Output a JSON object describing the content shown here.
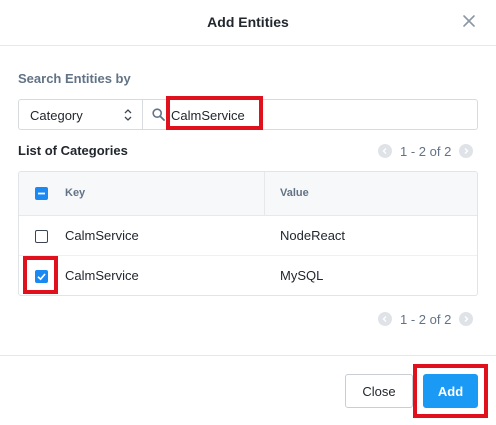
{
  "dialog": {
    "title": "Add Entities"
  },
  "search": {
    "label": "Search Entities by",
    "filter_selected": "Category",
    "query": "CalmService"
  },
  "list": {
    "label": "List of Categories",
    "pagination_top": "1 - 2 of 2",
    "pagination_bottom": "1 - 2 of 2",
    "columns": [
      "Key",
      "Value"
    ],
    "rows": [
      {
        "key": "CalmService",
        "value": "NodeReact",
        "checked": false
      },
      {
        "key": "CalmService",
        "value": "MySQL",
        "checked": true
      }
    ]
  },
  "footer": {
    "close_label": "Close",
    "add_label": "Add"
  },
  "colors": {
    "accent": "#1b9af5",
    "highlight": "#e0101c"
  }
}
